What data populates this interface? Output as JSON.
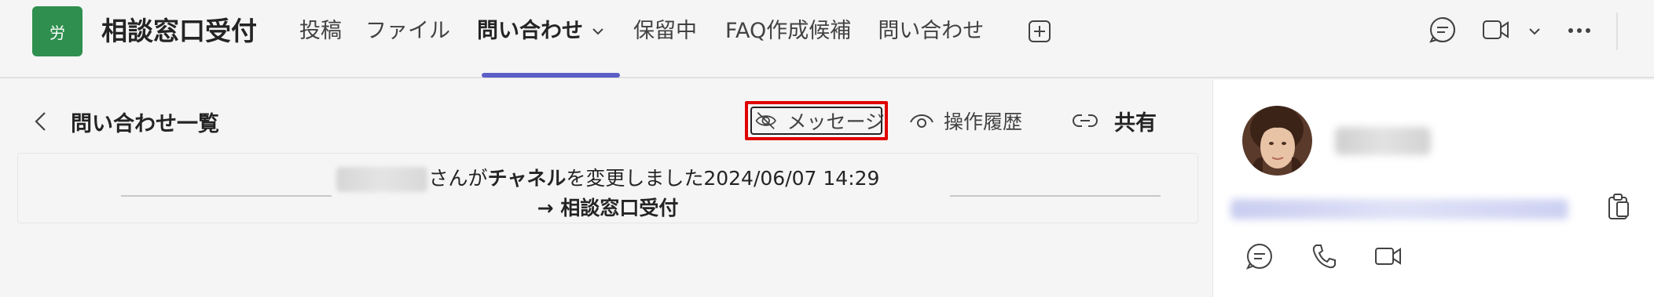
{
  "header": {
    "app_tile_char": "労",
    "channel_title": "相談窓口受付",
    "tabs": [
      {
        "label": "投稿",
        "active": false
      },
      {
        "label": "ファイル",
        "active": false
      },
      {
        "label": "問い合わせ",
        "active": true
      },
      {
        "label": "保留中",
        "active": false
      },
      {
        "label": "FAQ作成候補",
        "active": false
      },
      {
        "label": "問い合わせ",
        "active": false
      }
    ],
    "icons": [
      "add-tab-icon",
      "chat-icon",
      "video-call-icon",
      "chevron-down-icon",
      "more-icon"
    ]
  },
  "main": {
    "back_label": "問い合わせ一覧",
    "toolbar": {
      "message_label": "メッセージ",
      "history_label": "操作履歴",
      "share_label": "共有"
    },
    "event": {
      "suffix_a": "さんが",
      "channel_word": "チャネル",
      "suffix_b": "を変更しました",
      "timestamp": "2024/06/07 14:29",
      "arrow": "→",
      "new_channel": "相談窓口受付"
    }
  },
  "side_panel": {
    "icons": [
      "chat-icon",
      "phone-icon",
      "video-icon",
      "copy-icon"
    ]
  },
  "colors": {
    "accent": "#5b5fc7",
    "app_tile": "#2f8f4e",
    "highlight_box": "#e00000"
  }
}
